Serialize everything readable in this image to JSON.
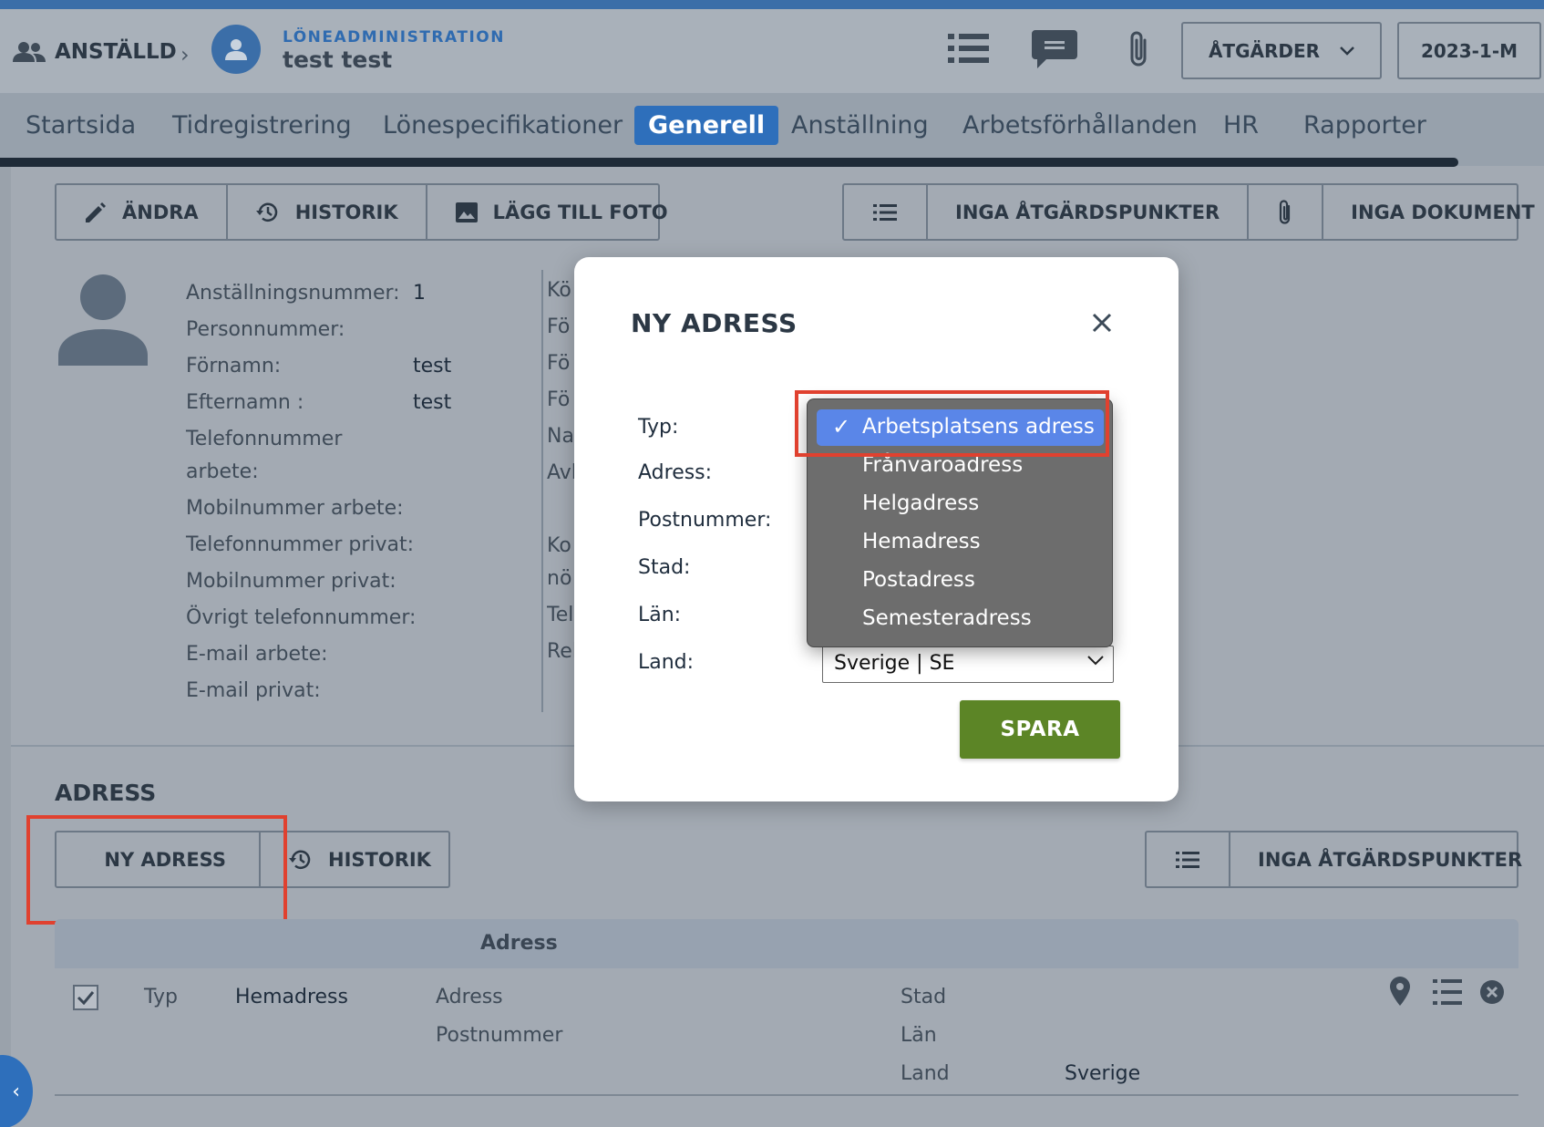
{
  "header": {
    "breadcrumb_root": "ANSTÄLLD",
    "module_label": "LÖNEADMINISTRATION",
    "user_name": "test test",
    "actions_label": "ÅTGÄRDER",
    "period_label": "2023-1-M"
  },
  "tabs": [
    "Startsida",
    "Tidregistrering",
    "Lönespecifikationer",
    "Generell",
    "Anställning",
    "Arbetsförhållanden",
    "HR",
    "Rapporter"
  ],
  "active_tab": "Generell",
  "toolbar": {
    "edit_label": "ÄNDRA",
    "history_label": "HISTORIK",
    "add_photo_label": "LÄGG TILL FOTO",
    "no_actions_label": "INGA ÅTGÄRDSPUNKTER",
    "no_documents_label": "INGA DOKUMENT"
  },
  "employee": {
    "fields": [
      {
        "label": "Anställningsnummer:",
        "value": "1"
      },
      {
        "label": "Personnummer:",
        "value": ""
      },
      {
        "label": "Förnamn:",
        "value": "test"
      },
      {
        "label": "Efternamn :",
        "value": "test"
      },
      {
        "label": "Telefonnummer",
        "value": ""
      },
      {
        "label": "arbete:",
        "value": ""
      },
      {
        "label": "Mobilnummer arbete:",
        "value": ""
      },
      {
        "label": "Telefonnummer privat:",
        "value": ""
      },
      {
        "label": "Mobilnummer privat:",
        "value": ""
      },
      {
        "label": "Övrigt telefonnummer:",
        "value": ""
      },
      {
        "label": "E-mail arbete:",
        "value": ""
      },
      {
        "label": "E-mail privat:",
        "value": ""
      }
    ],
    "right_column_partial": [
      "Kö",
      "Fö",
      "Fö",
      "Fö",
      "Na",
      "Avl",
      "Ko",
      "nö",
      "Tel",
      "Rel"
    ]
  },
  "address_section": {
    "title": "ADRESS",
    "new_address_label": "NY ADRESS",
    "history_label": "HISTORIK",
    "no_actions_label": "INGA ÅTGÄRDSPUNKTER",
    "table_header": "Adress",
    "row": {
      "typ_label": "Typ",
      "typ_value": "Hemadress",
      "adress_label": "Adress",
      "postnummer_label": "Postnummer",
      "stad_label": "Stad",
      "lan_label": "Län",
      "land_label": "Land",
      "land_value": "Sverige"
    }
  },
  "modal": {
    "title": "NY ADRESS",
    "labels": {
      "typ": "Typ:",
      "adress": "Adress:",
      "postnummer": "Postnummer:",
      "stad": "Stad:",
      "lan": "Län:",
      "land": "Land:"
    },
    "land_value": "Sverige | SE",
    "save_label": "SPARA"
  },
  "typ_dropdown": {
    "options": [
      "Arbetsplatsens adress",
      "Frånvaroadress",
      "Helgadress",
      "Hemadress",
      "Postadress",
      "Semesteradress"
    ],
    "selected": "Arbetsplatsens adress",
    "check_glyph": "✓"
  },
  "colors": {
    "brand_blue": "#2e6fbb",
    "save_green": "#5c8526",
    "highlight_red": "#e0412f",
    "dropdown_selected": "#5a86e8"
  }
}
